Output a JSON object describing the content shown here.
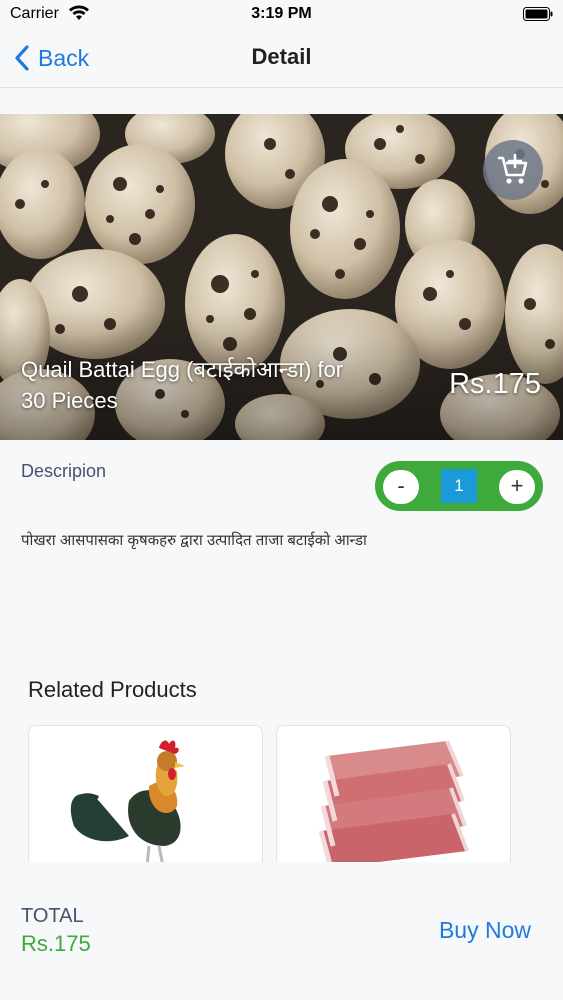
{
  "status_bar": {
    "carrier": "Carrier",
    "time": "3:19 PM"
  },
  "nav": {
    "back_label": "Back",
    "title": "Detail"
  },
  "product": {
    "name": "Quail Battai Egg (बटाईकोआन्डा) for 30 Pieces",
    "price": "Rs.175",
    "description_label": "Descripion",
    "description": "पोखरा आसपासका कृषकहरु द्वारा उत्पादित ताजा बटाईको आन्डा",
    "quantity": "1",
    "minus_label": "-",
    "plus_label": "+"
  },
  "related": {
    "title": "Related Products",
    "items": [
      {
        "icon": "rooster-image"
      },
      {
        "icon": "meat-image"
      }
    ]
  },
  "footer": {
    "total_label": "TOTAL",
    "total_value": "Rs.175",
    "buy_label": "Buy Now"
  },
  "colors": {
    "accent_blue": "#1f7ae0",
    "green": "#3eaa3b",
    "qty_blue": "#1a9ad8"
  }
}
